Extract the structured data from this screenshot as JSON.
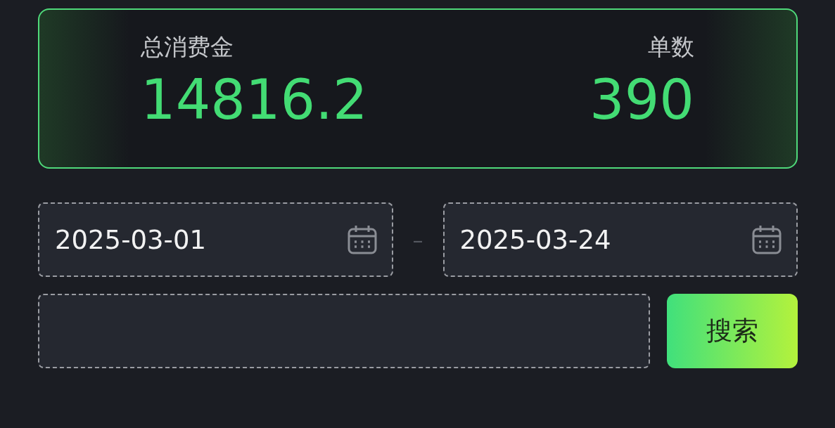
{
  "summary": {
    "stats": [
      {
        "label": "总消费金",
        "value": "14816.2"
      },
      {
        "label": "单数",
        "value": "390"
      }
    ]
  },
  "date_range": {
    "start": "2025-03-01",
    "separator": "–",
    "end": "2025-03-24"
  },
  "search": {
    "button": "搜索"
  }
}
